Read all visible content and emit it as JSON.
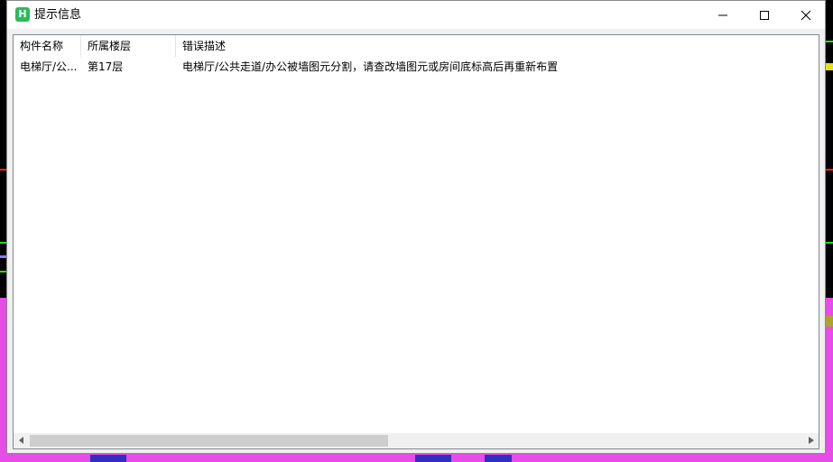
{
  "window": {
    "title": "提示信息",
    "app_icon_glyph": "H",
    "controls": {
      "minimize": "minimize-icon",
      "maximize": "maximize-icon",
      "close": "close-icon"
    }
  },
  "listview": {
    "columns": [
      {
        "label": "构件名称"
      },
      {
        "label": "所属楼层"
      },
      {
        "label": "错误描述"
      }
    ],
    "rows": [
      {
        "component": "电梯厅/公...",
        "floor": "第17层",
        "description": "电梯厅/公共走道/办公被墙图元分割，请查改墙图元或房间底标高后再重新布置"
      }
    ]
  },
  "colors": {
    "accent_icon": "#2dbb5a",
    "background_canvas": "#000000",
    "canvas_highlight": "#e64ce6"
  }
}
